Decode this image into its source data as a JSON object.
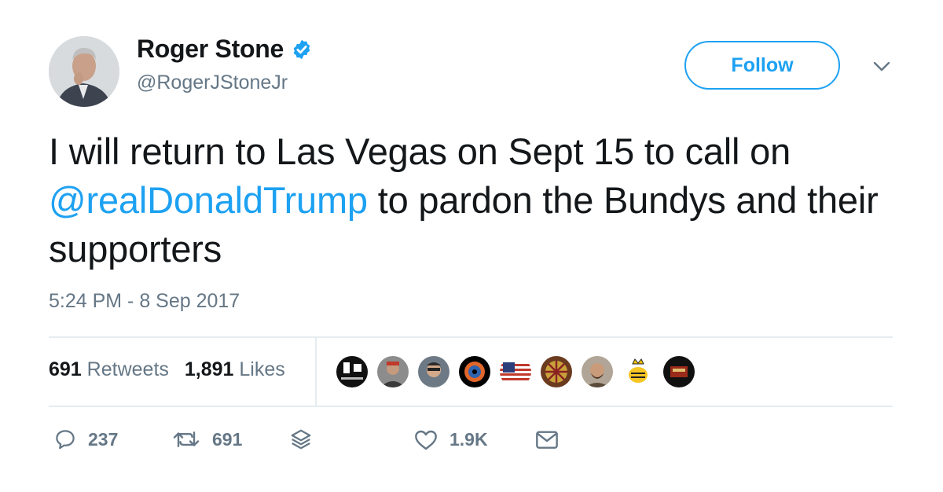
{
  "author": {
    "name": "Roger Stone",
    "handle": "@RogerJStoneJr",
    "verified": true,
    "avatar_icon": "profile-photo"
  },
  "follow_button": {
    "label": "Follow"
  },
  "tweet": {
    "text_before": "I will return to Las Vegas on Sept 15 to call on ",
    "mention": "@realDonaldTrump",
    "text_after": " to pardon the Bundys and their supporters",
    "timestamp": "5:24 PM - 8 Sep 2017"
  },
  "stats": {
    "retweets_count": "691",
    "retweets_label": "Retweets",
    "likes_count": "1,891",
    "likes_label": "Likes"
  },
  "likers": [
    "liker-avatar-1",
    "liker-avatar-2",
    "liker-avatar-3",
    "liker-avatar-4",
    "liker-avatar-5",
    "liker-avatar-6",
    "liker-avatar-7",
    "liker-avatar-8",
    "liker-avatar-9"
  ],
  "actions": {
    "reply_count": "237",
    "retweet_count": "691",
    "like_count": "1.9K"
  },
  "colors": {
    "accent": "#1da1f2",
    "text": "#14171a",
    "secondary": "#657786",
    "divider": "#e6ecf0"
  }
}
